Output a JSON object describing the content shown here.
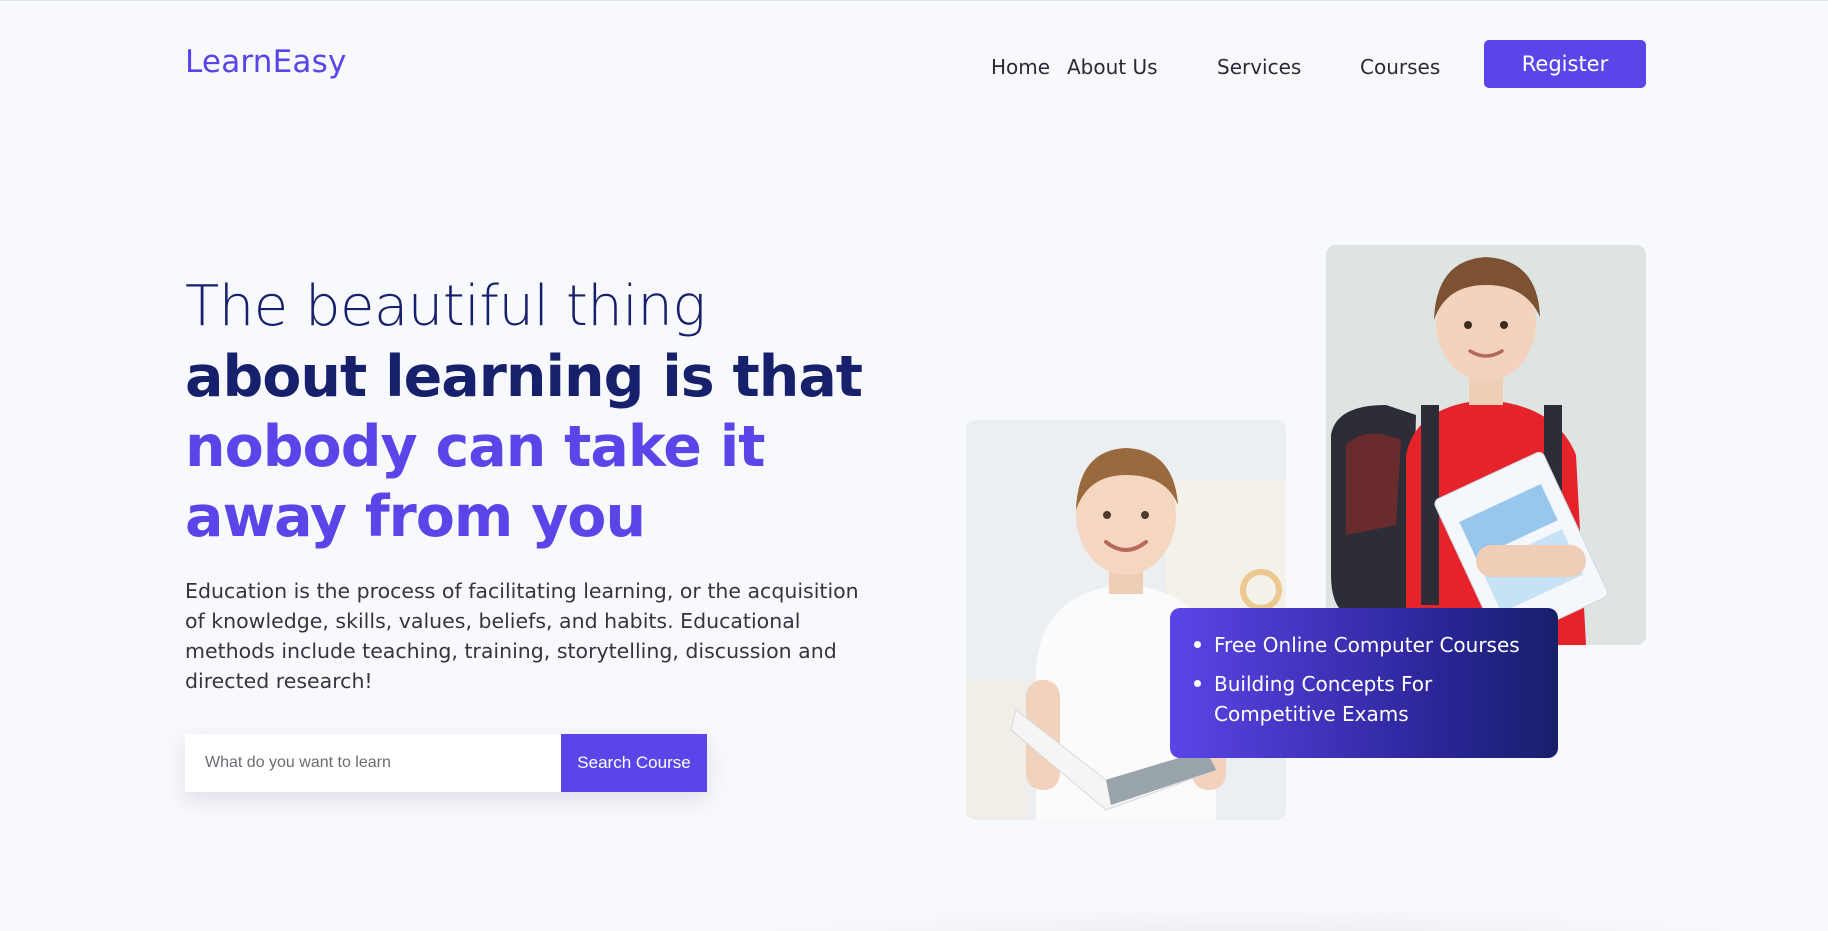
{
  "brand": {
    "logo": "LearnEasy"
  },
  "nav": {
    "items": [
      "Home",
      "About Us",
      "Services",
      "Courses"
    ],
    "register_label": "Register"
  },
  "hero": {
    "line1": "The beautiful thing",
    "line2": "about learning is that",
    "line3": "nobody can take it",
    "line4": "away from you",
    "description": "Education is the process of facilitating learning, or the acquisition of knowledge, skills, values, beliefs, and habits. Educational methods include teaching, training, storytelling, discussion and directed research!"
  },
  "search": {
    "placeholder": "What do you want to learn",
    "value": "",
    "button_label": "Search Course"
  },
  "info_card": {
    "items": [
      "Free Online Computer Courses",
      "Building Concepts For Competitive Exams"
    ]
  },
  "colors": {
    "accent": "#5b45e8",
    "navy": "#17206b",
    "background": "#f8f9fd"
  }
}
